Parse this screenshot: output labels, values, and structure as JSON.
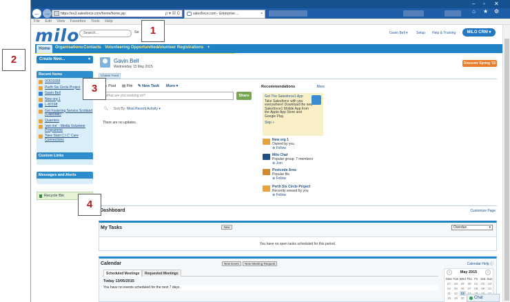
{
  "browser": {
    "address": "https://eu3.salesforce.com/home/home.jsp",
    "address_tools": "ρ ▾ ☒ C",
    "tab_title": "salesforce.com - Enterprise ...",
    "tab_close": "×"
  },
  "menubar": [
    "File",
    "Edit",
    "View",
    "Favorites",
    "Tools",
    "Help"
  ],
  "header": {
    "logo": "milo",
    "search_placeholder": "Search...",
    "search_button": "Se",
    "user_menu": "Gavin Bell ▾",
    "setup": "Setup",
    "help": "Help & Training",
    "app_button": "MILO CRM ▾"
  },
  "tabs": {
    "home": "Home",
    "items": [
      "Organisations",
      "Contacts",
      "Volunteering Opportunities",
      "Volunteer Registrations"
    ],
    "plus": "+"
  },
  "sidebar": {
    "create_new": "Create New...",
    "recent_title": "Recent Items",
    "recent_items": [
      {
        "label": "VOO1658",
        "color": "#e8a33a"
      },
      {
        "label": "Perth Six Circle Project",
        "color": "#e8a33a"
      },
      {
        "label": "Gavin Bell",
        "color": "#3a7bd0"
      },
      {
        "label": "New org 1",
        "color": "#e8a33a"
      },
      {
        "label": "L-82198",
        "color": "#3a7bd0"
      },
      {
        "label": "Get Fostering Service Scotland (Calendar)",
        "color": "#e8a33a"
      },
      {
        "label": "Quarriers",
        "color": "#e8a33a"
      },
      {
        "label": "'see me' - Media Volunteer Programme",
        "color": "#e8a33a"
      },
      {
        "label": "'New Start C.I.C' Care Connections",
        "color": "#e8a33a"
      }
    ],
    "custom_links": "Custom Links",
    "messages": "Messages and Alerts",
    "recycle": "Recycle Bin"
  },
  "profile": {
    "name": "Gavin Bell",
    "date": "Wednesday 13 May 2015",
    "spring_button": "Discover Spring '15",
    "hide_tab": "Chatter Feed"
  },
  "publisher": {
    "post": "Post",
    "file": "File",
    "new_task": "New Task",
    "more": "More ▾",
    "placeholder": "What are you working on?",
    "share": "Share",
    "sort_prefix": "Sort By:",
    "sort_value": "Most Recent Activity ▾",
    "empty": "There are no updates."
  },
  "recommendations": {
    "title": "Recommendations",
    "more": "More",
    "card_title": "Get The Salesforce1 App",
    "card_text": "Take Salesforce with you everywhere! Download the new Salesforce1 Mobile App from the Apple App Store and Google Play.",
    "skip": "Skip »",
    "items": [
      {
        "name": "New org 1",
        "detail": "Owned by you",
        "action": "Follow",
        "color": "#e8a33a"
      },
      {
        "name": "Milo Chat",
        "detail": "Popular group: 7 members",
        "action": "Join",
        "color": "#1f4f84"
      },
      {
        "name": "Postcode Area",
        "detail": "Popular file",
        "action": "Follow",
        "color": "#d28a2b"
      },
      {
        "name": "Perth Six Circle Project",
        "detail": "Recently viewed by you",
        "action": "Follow",
        "color": "#e8a33a"
      }
    ]
  },
  "dashboard": {
    "title": "Dashboard",
    "link": "Customize Page"
  },
  "tasks": {
    "title": "My Tasks",
    "new": "New",
    "select": "Overdue",
    "empty": "You have no open tasks scheduled for this period."
  },
  "calendar": {
    "title": "Calendar",
    "new_event": "New Event",
    "new_meeting": "New Meeting Request",
    "help": "Calendar Help",
    "tab_scheduled": "Scheduled Meetings",
    "tab_requested": "Requested Meetings",
    "today": "Today 13/05/2015",
    "none": "You have no events scheduled for the next 7 days.",
    "month": "May 2015",
    "weekdays": [
      "Mon",
      "Tue",
      "Wed",
      "Thu",
      "Fri",
      "Sat",
      "Sun"
    ],
    "rows": [
      [
        "27",
        "28",
        "29",
        "30",
        "01",
        "02",
        "03"
      ],
      [
        "04",
        "05",
        "06",
        "07",
        "08",
        "09",
        "10"
      ],
      [
        "11",
        "12",
        "13",
        "14",
        "15",
        "16",
        "17"
      ],
      [
        "18",
        "19",
        "20",
        "21",
        "22",
        "23",
        "24"
      ]
    ]
  },
  "chat": "Chat",
  "annotations": [
    "1",
    "2",
    "3",
    "4"
  ]
}
